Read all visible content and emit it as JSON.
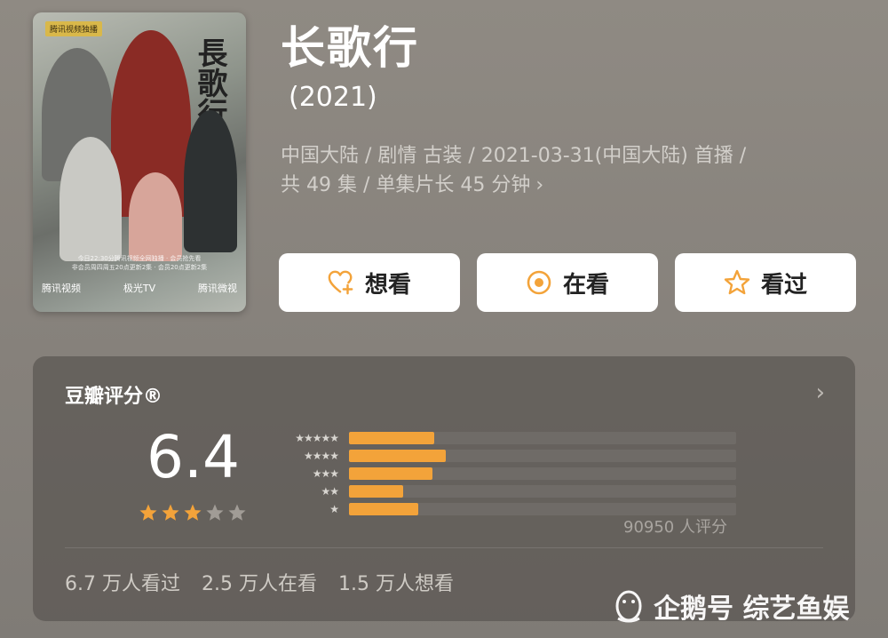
{
  "poster": {
    "badge": "腾讯视频独播",
    "calligraphy": "長歌行",
    "caption": "今日22:30分腾讯视频全网独播 · 会员抢先看",
    "caption2": "非会员周四周五20点更新2集 · 会员20点更新2集",
    "logos": [
      "腾讯视频",
      "极光TV",
      "腾讯微视"
    ]
  },
  "header": {
    "title": "长歌行",
    "year": "(2021)"
  },
  "meta": {
    "line1": "中国大陆 / 剧情 古装 / 2021-03-31(中国大陆) 首播 /",
    "line2": "共 49 集 / 单集片长 45 分钟",
    "chevron": "›"
  },
  "actions": {
    "want": "想看",
    "watching": "在看",
    "watched": "看过"
  },
  "rating": {
    "title": "豆瓣评分®",
    "score": "6.4",
    "stars_filled": 3,
    "stars_total": 5,
    "distribution": [
      {
        "stars": "★★★★★",
        "fraction": 0.22
      },
      {
        "stars": "★★★★",
        "fraction": 0.25
      },
      {
        "stars": "★★★",
        "fraction": 0.215
      },
      {
        "stars": "★★",
        "fraction": 0.14
      },
      {
        "stars": "★",
        "fraction": 0.18
      }
    ],
    "count": "90950 人评分",
    "stats": [
      "6.7 万人看过",
      "2.5 万人在看",
      "1.5 万人想看"
    ]
  },
  "watermark": {
    "text": "企鹅号 综艺鱼娱"
  },
  "colors": {
    "accent": "#f3a33a",
    "star_empty": "#a19c96",
    "card": "#5a5652"
  }
}
